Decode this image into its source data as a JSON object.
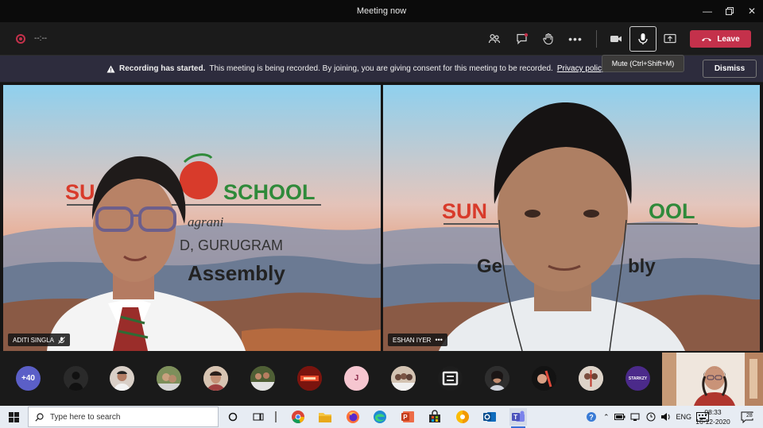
{
  "window": {
    "title": "Meeting now"
  },
  "toolbar": {
    "timer": "--:--",
    "leave_label": "Leave",
    "mic_tooltip": "Mute (Ctrl+Shift+M)"
  },
  "banner": {
    "bold_text": "Recording has started.",
    "text": "This meeting is being recorded. By joining, you are giving consent for this meeting to be recorded.",
    "link_text": "Privacy policy",
    "dismiss_label": "Dismiss"
  },
  "tiles": [
    {
      "name": "ADITI SINGLA",
      "backdrop": {
        "school_left": "SU",
        "school_right": "SCHOOL",
        "line1": "agrani",
        "line2": "D, GURUGRAM",
        "line3": "Assembly"
      }
    },
    {
      "name": "ESHAN IYER",
      "backdrop": {
        "school_left": "SUN",
        "school_right": "OOL",
        "line3_left": "Ge",
        "line3_right": "bly"
      }
    }
  ],
  "strip": {
    "overflow_count": "+40",
    "initial_avatar": "J",
    "last_avatar_text": "STARKZY"
  },
  "taskbar": {
    "search_placeholder": "Type here to search",
    "language": "ENG",
    "time": "08:33",
    "date": "16-12-2020",
    "notification_count": "28"
  },
  "colors": {
    "leave": "#c4314b",
    "banner": "#2d2c3d",
    "school_red": "#d83b2b",
    "school_green": "#2f8a3a"
  }
}
